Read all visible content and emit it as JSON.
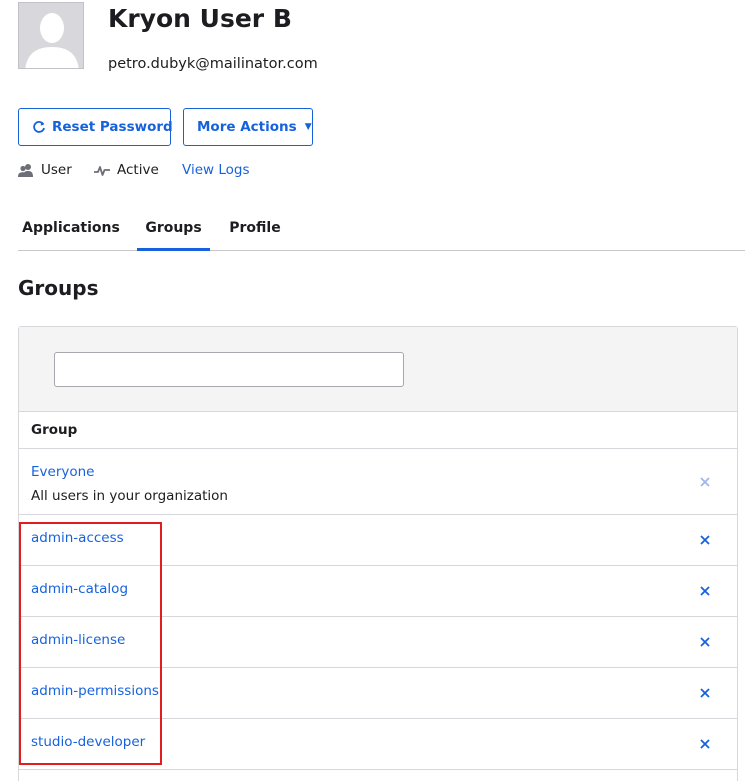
{
  "user": {
    "name": "Kryon User B",
    "email": "petro.dubyk@mailinator.com"
  },
  "actions": {
    "reset_password_label": "Reset Password",
    "more_actions_label": "More Actions"
  },
  "status": {
    "role": "User",
    "state": "Active",
    "logs_link": "View Logs"
  },
  "tabs": [
    {
      "label": "Applications",
      "active": false
    },
    {
      "label": "Groups",
      "active": true
    },
    {
      "label": "Profile",
      "active": false
    }
  ],
  "groups_section": {
    "title": "Groups",
    "search": {
      "value": "",
      "placeholder": ""
    },
    "column_header": "Group",
    "rows": [
      {
        "name": "Everyone",
        "description": "All users in your organization",
        "removable": false
      },
      {
        "name": "admin-access",
        "description": "",
        "removable": true
      },
      {
        "name": "admin-catalog",
        "description": "",
        "removable": true
      },
      {
        "name": "admin-license",
        "description": "",
        "removable": true
      },
      {
        "name": "admin-permissions",
        "description": "",
        "removable": true
      },
      {
        "name": "studio-developer",
        "description": "",
        "removable": true
      }
    ]
  },
  "colors": {
    "accent": "#1662dd",
    "highlight": "#e11d1d",
    "disabled_remove": "#9db6ec"
  }
}
